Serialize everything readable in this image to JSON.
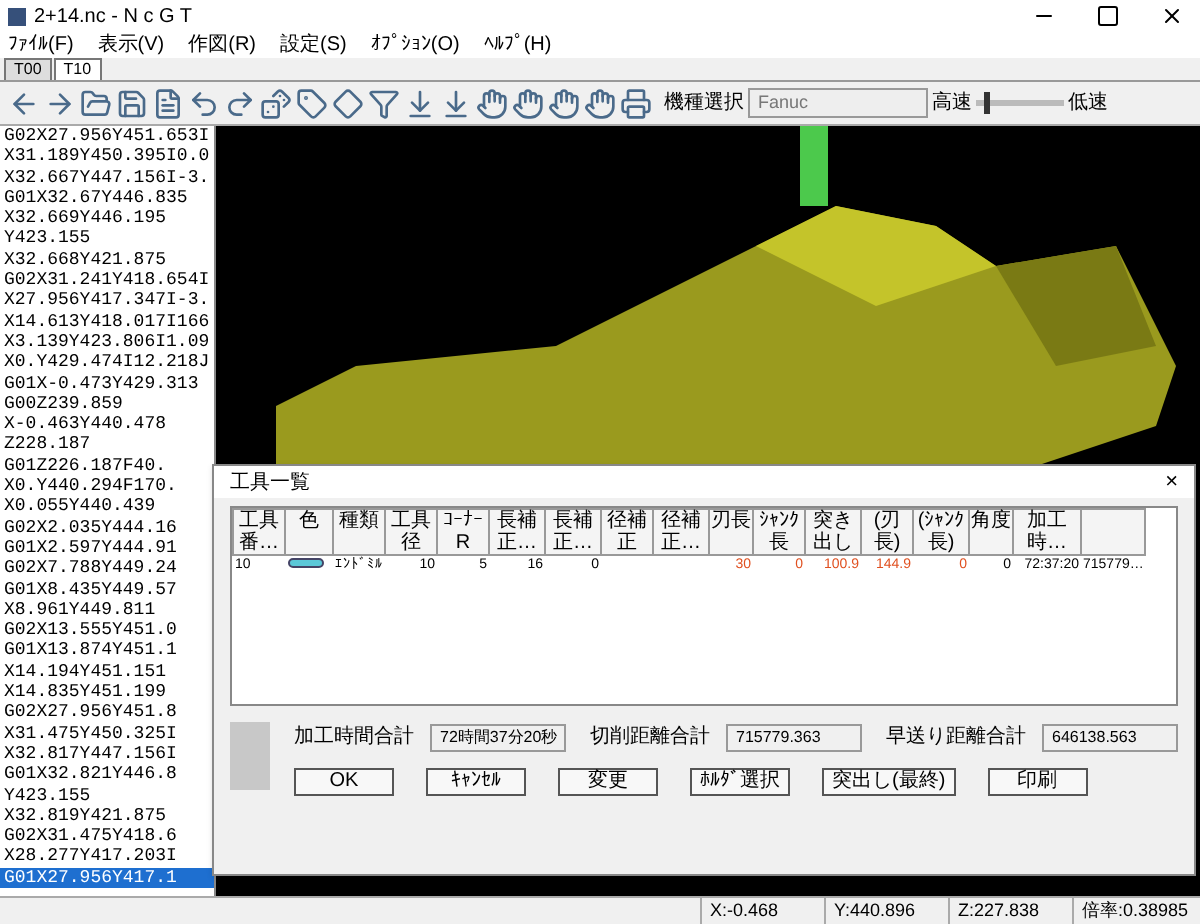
{
  "window": {
    "title": "2+14.nc - N c G T"
  },
  "menu": [
    "ﾌｧｲﾙ(F)",
    "表示(V)",
    "作図(R)",
    "設定(S)",
    "ｵﾌﾟｼｮﾝ(O)",
    "ﾍﾙﾌﾟ(H)"
  ],
  "tabs": [
    {
      "label": "T00",
      "selected": false
    },
    {
      "label": "T10",
      "selected": true
    }
  ],
  "toolbar": {
    "machine_label": "機種選択",
    "machine_value": "Fanuc",
    "fast_label": "高速",
    "slow_label": "低速",
    "speed": {
      "level": 0.1
    }
  },
  "code_lines": [
    {
      "text": "G02X27.956Y451.653I",
      "selected": false
    },
    {
      "text": "X31.189Y450.395I0.0",
      "selected": false
    },
    {
      "text": "X32.667Y447.156I-3.",
      "selected": false
    },
    {
      "text": "G01X32.67Y446.835",
      "selected": false
    },
    {
      "text": "X32.669Y446.195",
      "selected": false
    },
    {
      "text": "Y423.155",
      "selected": false
    },
    {
      "text": "X32.668Y421.875",
      "selected": false
    },
    {
      "text": "G02X31.241Y418.654I",
      "selected": false
    },
    {
      "text": "X27.956Y417.347I-3.",
      "selected": false
    },
    {
      "text": "X14.613Y418.017I166",
      "selected": false
    },
    {
      "text": "X3.139Y423.806I1.09",
      "selected": false
    },
    {
      "text": "X0.Y429.474I12.218J",
      "selected": false
    },
    {
      "text": "G01X-0.473Y429.313",
      "selected": false
    },
    {
      "text": "G00Z239.859",
      "selected": false
    },
    {
      "text": "X-0.463Y440.478",
      "selected": false
    },
    {
      "text": "Z228.187",
      "selected": false
    },
    {
      "text": "G01Z226.187F40.",
      "selected": false
    },
    {
      "text": "X0.Y440.294F170.",
      "selected": false
    },
    {
      "text": "X0.055Y440.439",
      "selected": false
    },
    {
      "text": "G02X2.035Y444.16",
      "selected": false
    },
    {
      "text": "G01X2.597Y444.91",
      "selected": false
    },
    {
      "text": "G02X7.788Y449.24",
      "selected": false
    },
    {
      "text": "G01X8.435Y449.57",
      "selected": false
    },
    {
      "text": "X8.961Y449.811",
      "selected": false
    },
    {
      "text": "G02X13.555Y451.0",
      "selected": false
    },
    {
      "text": "G01X13.874Y451.1",
      "selected": false
    },
    {
      "text": "X14.194Y451.151",
      "selected": false
    },
    {
      "text": "X14.835Y451.199",
      "selected": false
    },
    {
      "text": "G02X27.956Y451.8",
      "selected": false
    },
    {
      "text": "X31.475Y450.325I",
      "selected": false
    },
    {
      "text": "X32.817Y447.156I",
      "selected": false
    },
    {
      "text": "G01X32.821Y446.8",
      "selected": false
    },
    {
      "text": "Y423.155",
      "selected": false
    },
    {
      "text": "X32.819Y421.875",
      "selected": false
    },
    {
      "text": "G02X31.475Y418.6",
      "selected": false
    },
    {
      "text": "X28.277Y417.203I",
      "selected": false
    },
    {
      "text": "G01X27.956Y417.1",
      "selected": true
    }
  ],
  "tool_dialog": {
    "title": "工具一覧",
    "close": "×",
    "columns": [
      "工具番…",
      "色",
      "種類",
      "工具径",
      "ｺｰﾅｰR",
      "長補正…",
      "長補正…",
      "径補正",
      "径補正…",
      "刃長",
      "ｼｬﾝｸ長",
      "突き出し",
      "(刃長)",
      "(ｼｬﾝｸ長)",
      "角度",
      "加工時…"
    ],
    "rows": [
      {
        "selected": false,
        "color": "#5bc8d8",
        "cells": [
          {
            "text": "10",
            "warn": false
          },
          {
            "kind": "swatch"
          },
          {
            "text": "ｴﾝﾄﾞﾐﾙ",
            "warn": false
          },
          {
            "text": "10",
            "warn": false
          },
          {
            "text": "5",
            "warn": false
          },
          {
            "text": "16",
            "warn": false
          },
          {
            "text": "0",
            "warn": false
          },
          {
            "text": ""
          },
          {
            "text": ""
          },
          {
            "text": "30",
            "warn": true
          },
          {
            "text": "0",
            "warn": true
          },
          {
            "text": "100.9",
            "warn": true
          },
          {
            "text": "144.9",
            "warn": true
          },
          {
            "text": "0",
            "warn": true
          },
          {
            "text": "0",
            "warn": false
          },
          {
            "text": "72:37:20",
            "warn": false
          },
          {
            "text": "715779…",
            "warn": false
          }
        ]
      }
    ],
    "totals": [
      {
        "label": "加工時間合計",
        "value": "72時間37分20秒"
      },
      {
        "label": "切削距離合計",
        "value": "715779.363"
      },
      {
        "label": "早送り距離合計",
        "value": "646138.563"
      }
    ],
    "buttons": [
      "OK",
      "ｷｬﾝｾﾙ",
      "変更",
      "ﾎﾙﾀﾞ選択",
      "突出し(最終)",
      "印刷"
    ]
  },
  "status_bar": [
    "X:-0.468",
    "Y:440.896",
    "Z:227.838",
    "倍率:0.38985"
  ]
}
